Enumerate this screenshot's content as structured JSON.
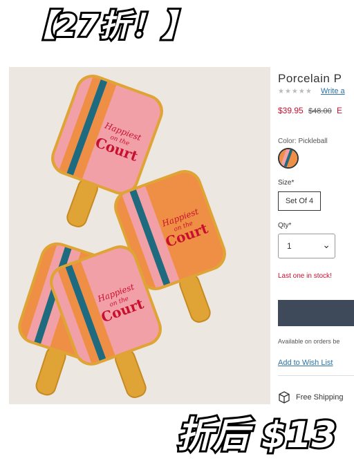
{
  "overlay": {
    "top_text": "【27折！】",
    "bottom_text": "折后 $13"
  },
  "product": {
    "title": "Porcelain P",
    "rating_stars": "★★★★★",
    "review_link": "Write a",
    "price_sale": "$39.95",
    "price_original": "$48.00",
    "price_extra": "E",
    "color_label": "Color: Pickleball",
    "size_label": "Size*",
    "size_option": "Set Of 4",
    "qty_label": "Qty*",
    "qty_value": "1",
    "stock_message": "Last one in stock!",
    "availability": "Available on orders be",
    "wishlist": "Add to Wish List",
    "shipping": "Free Shipping"
  },
  "image_text": {
    "line1": "Happiest",
    "line2": "on the",
    "line3": "Court"
  },
  "colors": {
    "sale_red": "#c8102e",
    "link_blue": "#2a72a8",
    "button_navy": "#3e4a5a",
    "paddle_pink": "#f2a0a8",
    "paddle_orange": "#ef8f45",
    "stripe_teal": "#1e6b80",
    "rim_gold": "#e0a436"
  }
}
